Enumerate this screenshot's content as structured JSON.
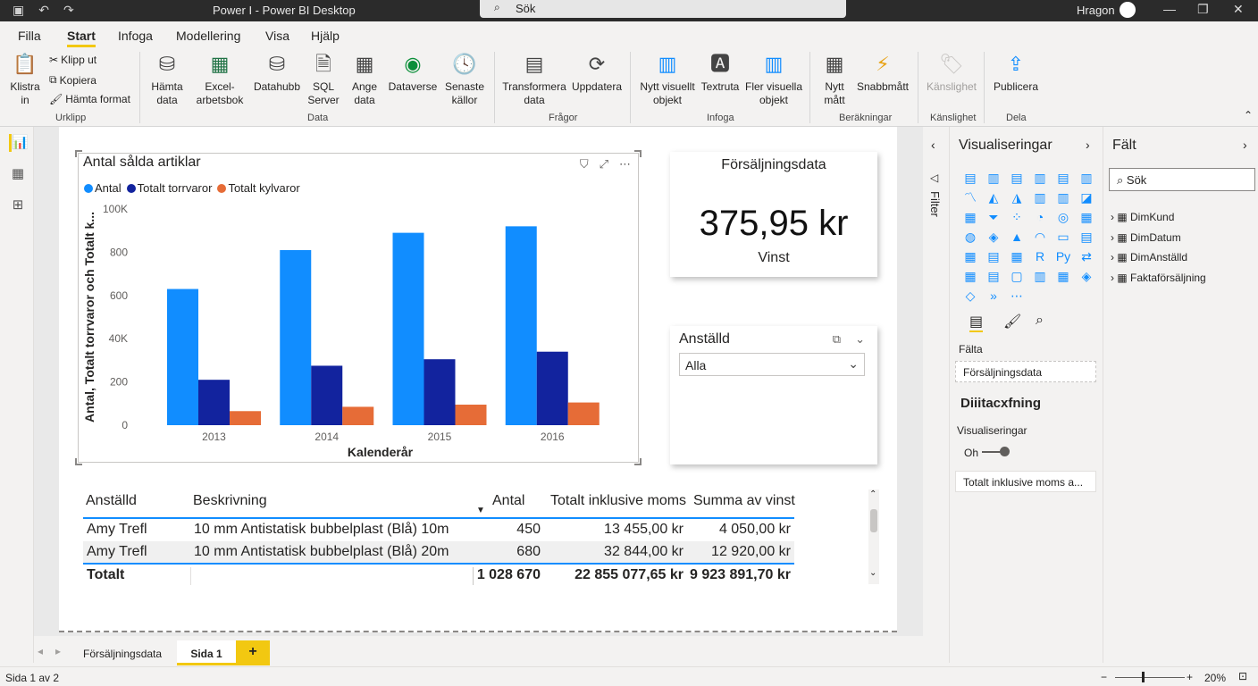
{
  "titlebar": {
    "title": "Power I - Power BI Desktop",
    "search": "Sök",
    "user": "Hragon"
  },
  "menu": {
    "items": [
      "Filla",
      "Start",
      "Infoga",
      "Modellering",
      "Visa",
      "Hjälp"
    ]
  },
  "ribbon": {
    "urklipp": {
      "paste": "Klistra in",
      "cut": "Klipp ut",
      "copy": "Kopiera",
      "format": "Hämta format",
      "group": "Urklipp"
    },
    "data": {
      "get": "Hämta data",
      "excel": "Excel-arbetsbok",
      "datahub": "Datahubb",
      "sql": "SQL Server",
      "enter": "Ange data",
      "dataverse": "Dataverse",
      "recent": "Senaste källor",
      "group": "Data"
    },
    "fragor": {
      "transform": "Transformera data",
      "refresh": "Uppdatera",
      "group": "Frågor"
    },
    "infoga": {
      "newvisual": "Nytt visuellt objekt",
      "textbox": "Textruta",
      "more": "Fler visuella objekt",
      "group": "Infoga"
    },
    "berakningar": {
      "measure": "Nytt mått",
      "quick": "Snabbmått",
      "group": "Beräkningar"
    },
    "kanslighet": {
      "label": "Känslighet",
      "group": "Känslighet"
    },
    "dela": {
      "publish": "Publicera",
      "group": "Dela"
    }
  },
  "chart_data": {
    "type": "bar",
    "title": "Antal sålda artiklar",
    "xlabel": "Kalenderår",
    "ylabel": "Antal, Totalt torrvaror och Totalt k...",
    "categories": [
      "2013",
      "2014",
      "2015",
      "2016"
    ],
    "yticks": [
      "0",
      "200",
      "40K",
      "600",
      "800",
      "100K"
    ],
    "ylim": [
      0,
      1000
    ],
    "series": [
      {
        "name": "Antal",
        "color": "#118dff",
        "values": [
          630,
          810,
          890,
          920
        ]
      },
      {
        "name": "Totalt torrvaror",
        "color": "#12239e",
        "values": [
          210,
          275,
          305,
          340
        ]
      },
      {
        "name": "Totalt kylvaror",
        "color": "#e66c37",
        "values": [
          65,
          85,
          95,
          105
        ]
      }
    ],
    "legend": "top-left"
  },
  "card": {
    "title": "Försäljningsdata",
    "value": "375,95 kr",
    "label": "Vinst"
  },
  "slicer": {
    "title": "Anställd",
    "value": "Alla"
  },
  "table": {
    "headers": [
      "Anställd",
      "Beskrivning",
      "Antal",
      "Totalt inklusive moms",
      "Summa av vinst"
    ],
    "rows": [
      [
        "Amy Trefl",
        "10 mm Antistatisk bubbelplast (Blå) 10m",
        "450",
        "13 455,00 kr",
        "4 050,00 kr"
      ],
      [
        "Amy Trefl",
        "10 mm Antistatisk bubbelplast (Blå) 20m",
        "680",
        "32 844,00 kr",
        "12 920,00 kr"
      ]
    ],
    "total": [
      "Totalt",
      "",
      "1 028 670",
      "22 855 077,65 kr",
      "9 923 891,70 kr"
    ]
  },
  "filters": {
    "label": "Filter"
  },
  "viz": {
    "title": "Visualiseringar",
    "fields_label": "Fälta",
    "field_value": "Försäljningsdata",
    "drill": "Diiitacxfning",
    "viz_label": "Visualiseringar",
    "toggle": "Oh",
    "drill_field": "Totalt inklusive moms a..."
  },
  "fields": {
    "title": "Fält",
    "search": "Sök",
    "tables": [
      "DimKund",
      "DimDatum",
      "DimAnställd",
      "Faktaförsäljning"
    ]
  },
  "tabs": {
    "items": [
      "Försäljningsdata",
      "Sida 1"
    ],
    "add": "+"
  },
  "status": {
    "page": "Sida 1 av 2",
    "zoom": "20%"
  },
  "colors": {
    "accent": "#f2c811",
    "series1": "#118dff",
    "series2": "#12239e",
    "series3": "#e66c37"
  }
}
